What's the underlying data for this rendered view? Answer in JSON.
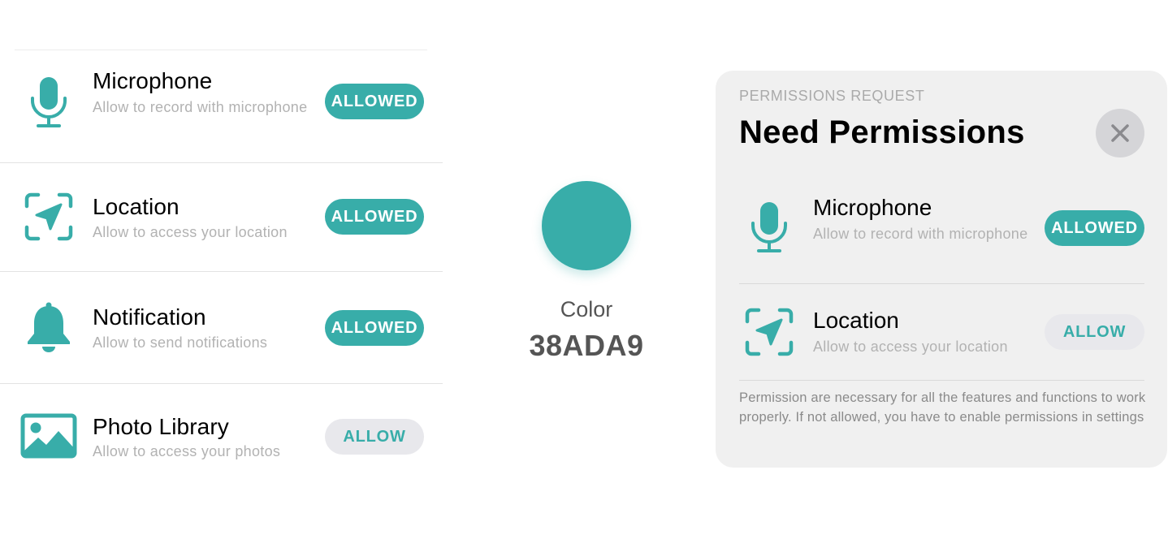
{
  "accent_color": "#38ada9",
  "permissions": [
    {
      "icon": "microphone-icon",
      "title": "Microphone",
      "description": "Allow to record with microphone",
      "button": "ALLOWED",
      "state": "allowed"
    },
    {
      "icon": "location-icon",
      "title": "Location",
      "description": "Allow to access your location",
      "button": "ALLOWED",
      "state": "allowed"
    },
    {
      "icon": "bell-icon",
      "title": "Notification",
      "description": "Allow to send notifications",
      "button": "ALLOWED",
      "state": "allowed"
    },
    {
      "icon": "photo-icon",
      "title": "Photo Library",
      "description": "Allow to access your photos",
      "button": "ALLOW",
      "state": "not-allowed"
    }
  ],
  "swatch": {
    "label": "Color",
    "hex": "38ADA9",
    "color": "#38ada9"
  },
  "modal": {
    "eyebrow": "PERMISSIONS REQUEST",
    "title": "Need Permissions",
    "close_icon": "close-icon",
    "items": [
      {
        "icon": "microphone-icon",
        "title": "Microphone",
        "description": "Allow to record with microphone",
        "button": "ALLOWED",
        "state": "allowed"
      },
      {
        "icon": "location-icon",
        "title": "Location",
        "description": "Allow to access your location",
        "button": "ALLOW",
        "state": "not-allowed"
      }
    ],
    "footer": "Permission are necessary for all the features and functions to work properly. If not allowed, you have to enable permissions in settings"
  }
}
